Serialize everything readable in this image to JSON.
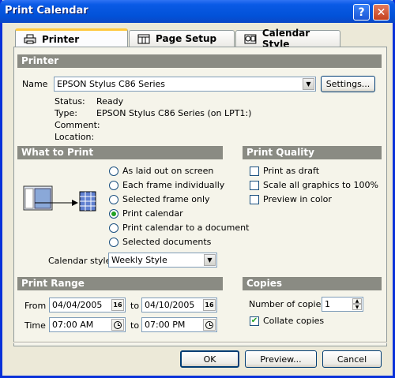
{
  "window": {
    "title": "Print Calendar"
  },
  "tabs": [
    {
      "label": "Printer",
      "icon": "printer-icon"
    },
    {
      "label": "Page Setup",
      "icon": "page-setup-icon"
    },
    {
      "label": "Calendar Style",
      "icon": "calendar-style-icon"
    }
  ],
  "printer": {
    "header": "Printer",
    "name_label": "Name",
    "name_value": "EPSON Stylus C86 Series",
    "settings_label": "Settings...",
    "status_label": "Status:",
    "status_value": "Ready",
    "type_label": "Type:",
    "type_value": "EPSON Stylus C86 Series (on LPT1:)",
    "comment_label": "Comment:",
    "location_label": "Location:"
  },
  "what_to_print": {
    "header": "What to Print",
    "options": [
      {
        "label": "As laid out on screen",
        "selected": false
      },
      {
        "label": "Each frame individually",
        "selected": false
      },
      {
        "label": "Selected frame only",
        "selected": false
      },
      {
        "label": "Print calendar",
        "selected": true
      },
      {
        "label": "Print calendar to a document",
        "selected": false
      },
      {
        "label": "Selected documents",
        "selected": false
      }
    ],
    "calendar_style_label": "Calendar style",
    "calendar_style_value": "Weekly Style"
  },
  "print_quality": {
    "header": "Print Quality",
    "options": [
      {
        "label": "Print as draft",
        "checked": false
      },
      {
        "label": "Scale all graphics to 100%",
        "checked": false
      },
      {
        "label": "Preview in color",
        "checked": false
      }
    ]
  },
  "print_range": {
    "header": "Print Range",
    "from_label": "From",
    "from_date": "04/04/2005",
    "to_label": "to",
    "to_date": "04/10/2005",
    "date_btn": "16",
    "time_label": "Time",
    "from_time": "07:00 AM",
    "to_time": "07:00 PM"
  },
  "copies": {
    "header": "Copies",
    "number_label": "Number of copies",
    "number_value": "1",
    "collate_label": "Collate copies",
    "collate_checked": true
  },
  "footer": {
    "ok_label": "OK",
    "preview_label": "Preview...",
    "cancel_label": "Cancel"
  },
  "colors": {
    "titlebar": "#0252d8",
    "section_header": "#8a8b83",
    "radio_dot": "#21a121"
  }
}
